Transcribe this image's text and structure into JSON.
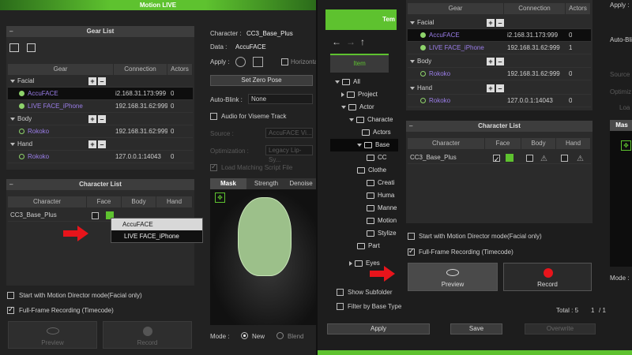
{
  "colors": {
    "accent_green": "#5ec22f",
    "arrow_red": "#e8141b",
    "purple_text": "#9a7de8"
  },
  "window_title": "Motion LIVE",
  "left": {
    "gear_list_title": "Gear List",
    "gear_headers": [
      "Gear",
      "Connection",
      "Actors"
    ],
    "groups": [
      {
        "name": "Facial",
        "items": [
          {
            "name": "AccuFACE",
            "connection": "i2.168.31.173:999",
            "actors": "0",
            "selected": true
          },
          {
            "name": "LIVE FACE_iPhone",
            "connection": "192.168.31.62:999",
            "actors": "0"
          }
        ]
      },
      {
        "name": "Body",
        "items": [
          {
            "name": "Rokoko",
            "connection": "192.168.31.62:999",
            "actors": "0"
          }
        ]
      },
      {
        "name": "Hand",
        "items": [
          {
            "name": "Rokoko",
            "connection": "127.0.0.1:14043",
            "actors": "0"
          }
        ]
      }
    ],
    "char_list_title": "Character List",
    "char_headers": [
      "Character",
      "Face",
      "Body",
      "Hand"
    ],
    "character": "CC3_Base_Plus",
    "dropdown": [
      "AccuFACE",
      "LIVE FACE_iPhone"
    ],
    "opt1": "Start with Motion Director mode(Facial only)",
    "opt2": "Full-Frame Recording (Timecode)",
    "preview": "Preview",
    "record": "Record"
  },
  "mid": {
    "character_label": "Character :",
    "character_value": "CC3_Base_Plus",
    "data_label": "Data :",
    "data_value": "AccuFACE",
    "apply_label": "Apply :",
    "horizontal": "Horizonta",
    "zero_pose": "Set Zero Pose",
    "auto_blink_label": "Auto-Blink :",
    "auto_blink_value": "None",
    "audio_viseme": "Audio for Viseme Track",
    "source_label": "Source :",
    "source_value": "AccuFACE Vi...",
    "optimization_label": "Optimization :",
    "optimization_value": "Legacy Lip-Sy...",
    "load_script": "Load Matching Script File",
    "tabs": [
      "Mask",
      "Strength",
      "Denoise"
    ],
    "mode_label": "Mode :",
    "mode_new": "New",
    "mode_blend": "Blend"
  },
  "right": {
    "panel_title": "Tem",
    "item_tab": "Item",
    "tree": [
      "All",
      "Project",
      "Actor",
      "Characte",
      "Actors",
      "Base",
      "CC",
      "Clothe",
      "Creati",
      "Huma",
      "Manne",
      "Motion",
      "Stylize",
      "Part",
      "Eyes"
    ],
    "show_subfolder": "Show Subfolder",
    "filter_base": "Filter by Base Type",
    "apply": "Apply",
    "gear_headers": [
      "Gear",
      "Connection",
      "Actors"
    ],
    "groups": [
      {
        "name": "Facial",
        "items": [
          {
            "name": "AccuFACE",
            "connection": "i2.168.31.173:999",
            "actors": "0",
            "selected": true
          },
          {
            "name": "LIVE FACE_iPhone",
            "connection": "192.168.31.62:999",
            "actors": "1"
          }
        ]
      },
      {
        "name": "Body",
        "items": [
          {
            "name": "Rokoko",
            "connection": "192.168.31.62:999",
            "actors": "0"
          }
        ]
      },
      {
        "name": "Hand",
        "items": [
          {
            "name": "Rokoko",
            "connection": "127.0.0.1:14043",
            "actors": "0"
          }
        ]
      }
    ],
    "char_list_title": "Character List",
    "char_headers": [
      "Character",
      "Face",
      "Body",
      "Hand"
    ],
    "character": "CC3_Base_Plus",
    "opt1": "Start with Motion Director mode(Facial only)",
    "opt2": "Full-Frame Recording (Timecode)",
    "preview": "Preview",
    "record": "Record",
    "total": "Total : 5",
    "page": "1",
    "page_total": "/ 1",
    "save": "Save",
    "overwrite": "Overwrite",
    "far_apply": "Apply :",
    "far_auto_blink": "Auto-Bli",
    "far_source": "Source",
    "far_optim": "Optimiz",
    "far_load": "Loa",
    "far_mask": "Mas",
    "far_mode": "Mode :"
  }
}
